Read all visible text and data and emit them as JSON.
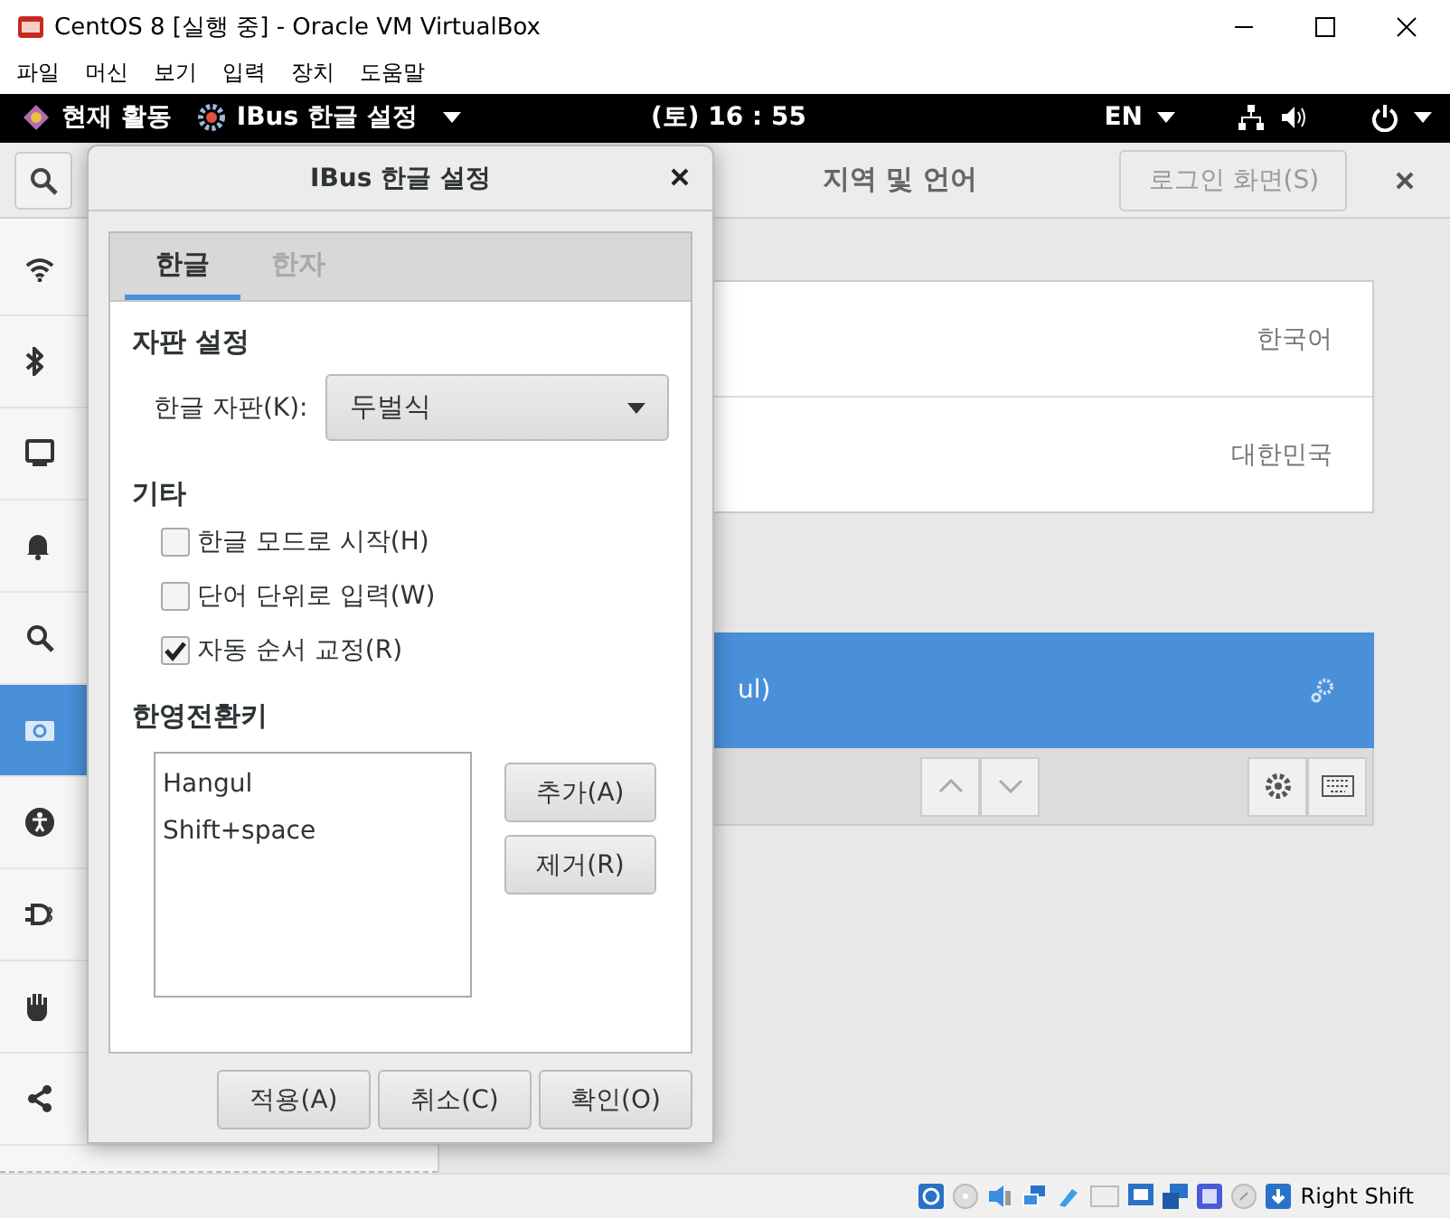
{
  "window": {
    "title": "CentOS 8 [실행 중] - Oracle VM VirtualBox"
  },
  "menu": [
    "파일",
    "머신",
    "보기",
    "입력",
    "장치",
    "도움말"
  ],
  "top_bar": {
    "activities": "현재 활동",
    "app_menu": "IBus 한글 설정",
    "clock": "(토) 16 : 55",
    "input_source": "EN"
  },
  "settings": {
    "title": "지역 및 언어",
    "login_screen_button": "로그인 화면(S)",
    "sidebar": [
      {
        "selected": false
      },
      {
        "selected": false
      },
      {
        "selected": false
      },
      {
        "selected": false
      },
      {
        "selected": false
      },
      {
        "selected": true
      },
      {
        "selected": false
      },
      {
        "selected": false
      },
      {
        "selected": false
      },
      {
        "selected": false
      }
    ],
    "language": "한국어",
    "formats": "대한민국",
    "input_sources": [
      {
        "label": "ul)",
        "selected": true
      }
    ]
  },
  "dialog": {
    "title": "IBus 한글 설정",
    "tabs": [
      {
        "label": "한글",
        "selected": true
      },
      {
        "label": "한자",
        "selected": false
      }
    ],
    "keyboard_section": "자판 설정",
    "layout_label": "한글 자판(K):",
    "layout_value": "두벌식",
    "other_section": "기타",
    "options": [
      {
        "label": "한글 모드로 시작(H)",
        "checked": false
      },
      {
        "label": "단어 단위로 입력(W)",
        "checked": false
      },
      {
        "label": "자동 순서 교정(R)",
        "checked": true
      }
    ],
    "hotkey_section": "한영전환키",
    "hotkeys": [
      "Hangul",
      "Shift+space"
    ],
    "side_buttons": [
      "추가(A)",
      "제거(R)"
    ],
    "buttons": [
      "적용(A)",
      "취소(C)",
      "확인(O)"
    ]
  },
  "status_bar": {
    "host_key": "Right Shift"
  }
}
